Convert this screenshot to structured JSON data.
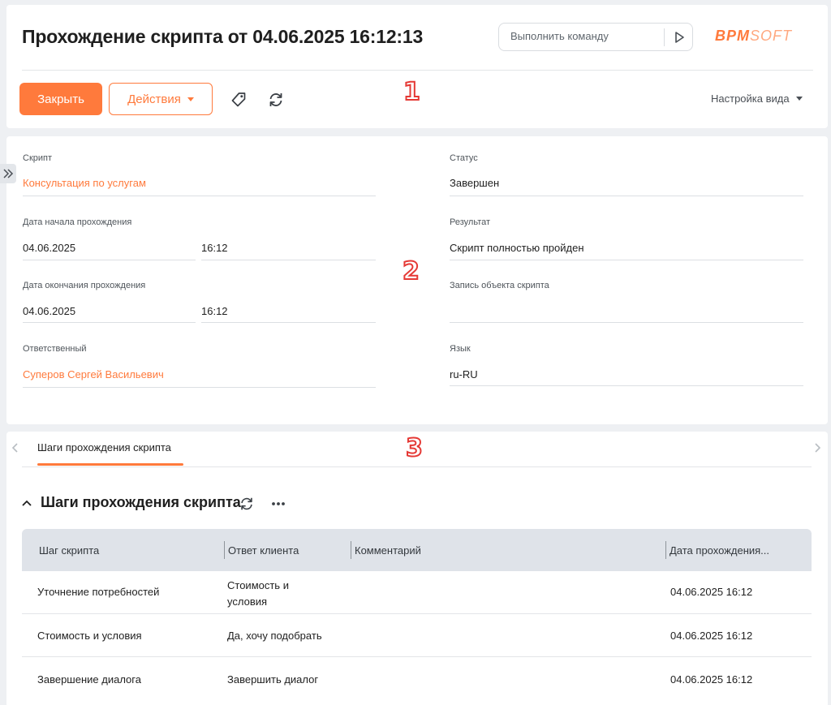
{
  "header": {
    "title": "Прохождение скрипта от 04.06.2025 16:12:13",
    "command_placeholder": "Выполнить команду",
    "logo_part1": "BPM",
    "logo_part2": "SOFT",
    "close_label": "Закрыть",
    "actions_label": "Действия",
    "view_settings_label": "Настройка вида"
  },
  "markers": [
    "1",
    "2",
    "3"
  ],
  "form": {
    "script": {
      "label": "Скрипт",
      "value": "Консультация по услугам"
    },
    "start": {
      "label": "Дата начала прохождения",
      "date": "04.06.2025",
      "time": "16:12"
    },
    "end": {
      "label": "Дата окончания прохождения",
      "date": "04.06.2025",
      "time": "16:12"
    },
    "owner": {
      "label": "Ответственный",
      "value": "Суперов Сергей Васильевич"
    },
    "status": {
      "label": "Статус",
      "value": "Завершен"
    },
    "result": {
      "label": "Результат",
      "value": "Скрипт полностью пройден"
    },
    "object_record": {
      "label": "Запись объекта скрипта",
      "value": ""
    },
    "language": {
      "label": "Язык",
      "value": "ru-RU"
    }
  },
  "tabs": [
    {
      "label": "Шаги прохождения скрипта"
    }
  ],
  "detail": {
    "title": "Шаги прохождения скрипта",
    "columns": [
      "Шаг скрипта",
      "Ответ клиента",
      "Комментарий",
      "Дата прохождения..."
    ],
    "rows": [
      {
        "step": "Уточнение потребностей",
        "answer": "Стоимость и условия",
        "comment": "",
        "date": "04.06.2025 16:12"
      },
      {
        "step": "Стоимость и условия",
        "answer": "Да, хочу подобрать",
        "comment": "",
        "date": "04.06.2025 16:12"
      },
      {
        "step": "Завершение диалога",
        "answer": "Завершить диалог",
        "comment": "",
        "date": "04.06.2025 16:12"
      }
    ]
  },
  "colors": {
    "accent": "#ff7a3c",
    "marker": "#e53935"
  }
}
